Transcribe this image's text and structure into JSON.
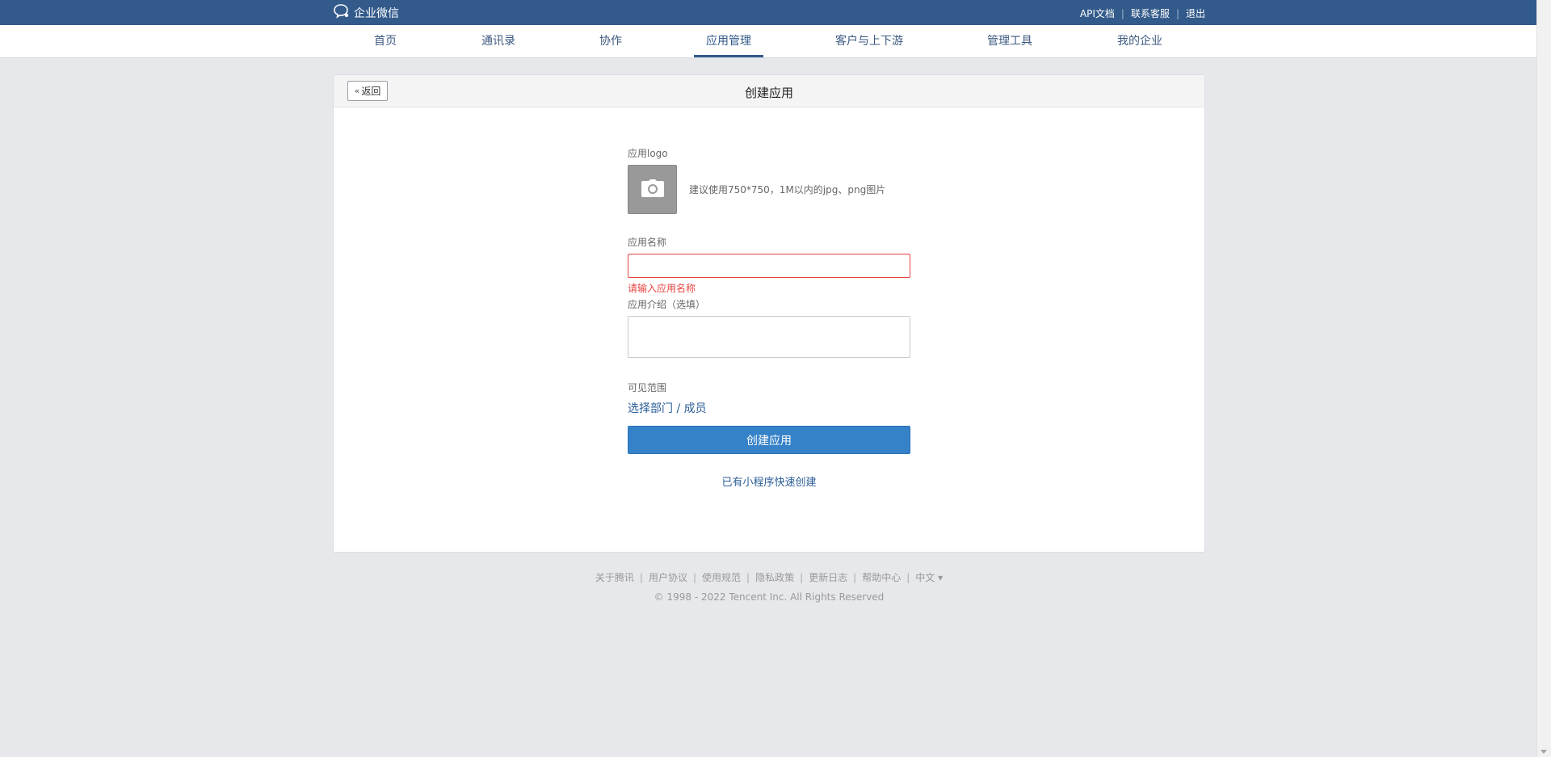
{
  "topbar": {
    "logo_text": "企业微信",
    "links": [
      "API文档",
      "联系客服",
      "退出"
    ]
  },
  "nav": {
    "items": [
      "首页",
      "通讯录",
      "协作",
      "应用管理",
      "客户与上下游",
      "管理工具",
      "我的企业"
    ],
    "active": "应用管理"
  },
  "card": {
    "back_label": "返回",
    "title": "创建应用"
  },
  "form": {
    "logo_label": "应用logo",
    "logo_hint": "建议使用750*750，1M以内的jpg、png图片",
    "name_label": "应用名称",
    "name_value": "",
    "name_error": "请输入应用名称",
    "intro_label": "应用介绍（选填）",
    "intro_value": "",
    "scope_label": "可见范围",
    "scope_link": "选择部门 / 成员",
    "submit_label": "创建应用",
    "quick_link": "已有小程序快速创建"
  },
  "footer": {
    "links": [
      "关于腾讯",
      "用户协议",
      "使用规范",
      "隐私政策",
      "更新日志",
      "帮助中心",
      "中文 ▾"
    ],
    "copyright": "© 1998 - 2022 Tencent Inc. All Rights Reserved"
  },
  "colors": {
    "topbar": "#325a8a",
    "accent": "#3682c8",
    "error": "#e64340",
    "link": "#2c5e97"
  }
}
